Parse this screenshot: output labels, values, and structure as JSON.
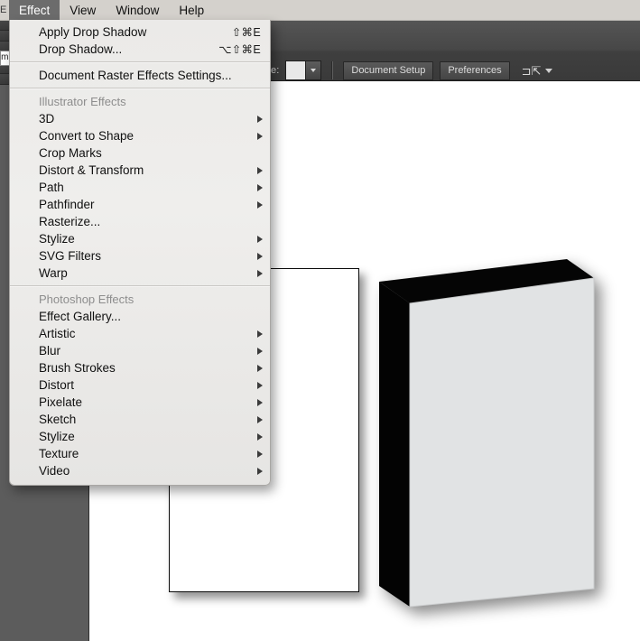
{
  "menubar": {
    "pre_fragment": "E",
    "items": [
      {
        "label": "Effect",
        "active": true
      },
      {
        "label": "View",
        "active": false
      },
      {
        "label": "Window",
        "active": false
      },
      {
        "label": "Help",
        "active": false
      }
    ]
  },
  "control_bar": {
    "style_label": "e:",
    "field_fragment": "Normal",
    "swatch_color": "#e8e8e8",
    "document_setup_label": "Document Setup",
    "preferences_label": "Preferences",
    "align_glyph": "⊐⇱"
  },
  "dropdown": {
    "top_items": [
      {
        "label": "Apply Drop Shadow",
        "shortcut": "⇧⌘E",
        "arrow": false
      },
      {
        "label": "Drop Shadow...",
        "shortcut": "⌥⇧⌘E",
        "arrow": false
      }
    ],
    "raster_item": {
      "label": "Document Raster Effects Settings...",
      "shortcut": "",
      "arrow": false
    },
    "illustrator_section": "Illustrator Effects",
    "illustrator_items": [
      {
        "label": "3D",
        "shortcut": "",
        "arrow": true
      },
      {
        "label": "Convert to Shape",
        "shortcut": "",
        "arrow": true
      },
      {
        "label": "Crop Marks",
        "shortcut": "",
        "arrow": false
      },
      {
        "label": "Distort & Transform",
        "shortcut": "",
        "arrow": true
      },
      {
        "label": "Path",
        "shortcut": "",
        "arrow": true
      },
      {
        "label": "Pathfinder",
        "shortcut": "",
        "arrow": true
      },
      {
        "label": "Rasterize...",
        "shortcut": "",
        "arrow": false
      },
      {
        "label": "Stylize",
        "shortcut": "",
        "arrow": true
      },
      {
        "label": "SVG Filters",
        "shortcut": "",
        "arrow": true
      },
      {
        "label": "Warp",
        "shortcut": "",
        "arrow": true
      }
    ],
    "photoshop_section": "Photoshop Effects",
    "photoshop_items": [
      {
        "label": "Effect Gallery...",
        "shortcut": "",
        "arrow": false
      },
      {
        "label": "Artistic",
        "shortcut": "",
        "arrow": true
      },
      {
        "label": "Blur",
        "shortcut": "",
        "arrow": true
      },
      {
        "label": "Brush Strokes",
        "shortcut": "",
        "arrow": true
      },
      {
        "label": "Distort",
        "shortcut": "",
        "arrow": true
      },
      {
        "label": "Pixelate",
        "shortcut": "",
        "arrow": true
      },
      {
        "label": "Sketch",
        "shortcut": "",
        "arrow": true
      },
      {
        "label": "Stylize",
        "shortcut": "",
        "arrow": true
      },
      {
        "label": "Texture",
        "shortcut": "",
        "arrow": true
      },
      {
        "label": "Video",
        "shortcut": "",
        "arrow": true
      }
    ]
  },
  "canvas": {
    "flat_rectangle_name": "flat-rectangle",
    "extruded_box_name": "extruded-3d-box",
    "box_front_color": "#e1e3e4",
    "box_side_color": "#050505",
    "rect_fill_color": "#ffffff",
    "rect_stroke_color": "#0a0a0a"
  }
}
